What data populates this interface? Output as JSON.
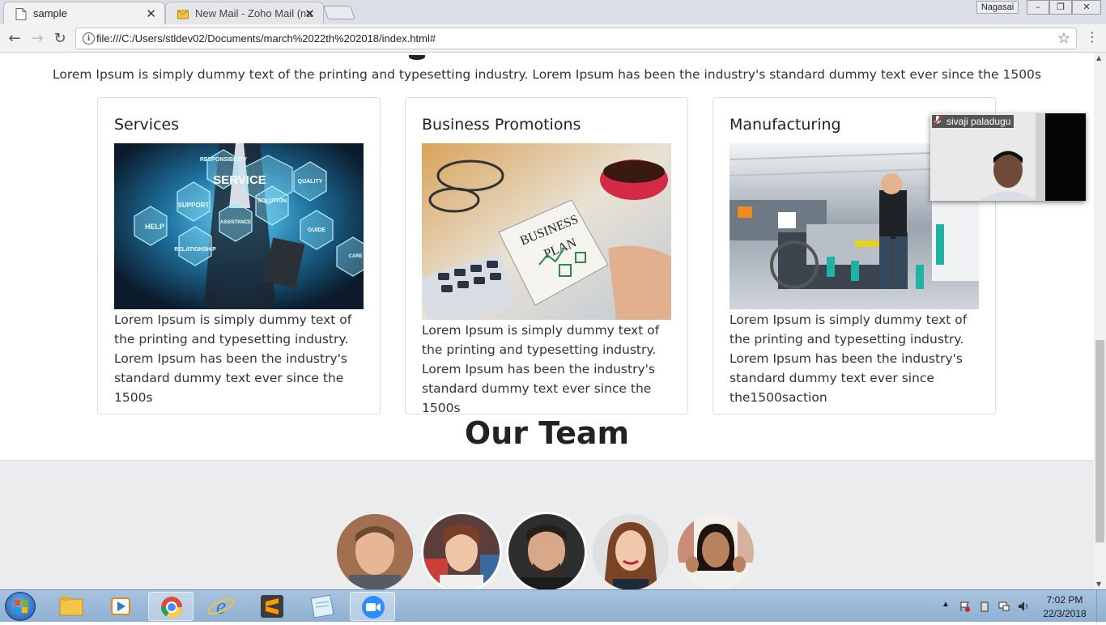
{
  "browser": {
    "tabs": [
      {
        "title": "sample",
        "active": true
      },
      {
        "title": "New Mail - Zoho Mail (na",
        "active": false
      }
    ],
    "user_chip": "Nagasai",
    "url": "file:///C:/Users/stldev02/Documents/march%2022th%202018/index.html#",
    "window_buttons": [
      "–",
      "❐",
      "✕"
    ]
  },
  "page": {
    "intro": "Lorem Ipsum is simply dummy text of the printing and typesetting industry. Lorem Ipsum has been the industry's standard dummy text ever since the 1500s",
    "cards": [
      {
        "title": "Services",
        "text": "Lorem Ipsum is simply dummy text of the printing and typesetting industry. Lorem Ipsum has been the industry's standard dummy text ever since the 1500s",
        "image_labels": [
          "RESPONSIBILITY",
          "SERVICE",
          "QUALITY",
          "SUPPORT",
          "SOLUTION",
          "HELP",
          "ASSISTANCE",
          "GUIDE",
          "RELATIONSHIP",
          "CARE"
        ]
      },
      {
        "title": "Business Promotions",
        "text": "Lorem Ipsum is simply dummy text of the printing and typesetting industry. Lorem Ipsum has been the industry's standard dummy text ever since the 1500s",
        "image_labels": [
          "BUSINESS",
          "PLAN"
        ]
      },
      {
        "title": "Manufacturing",
        "text": "Lorem Ipsum is simply dummy text of the printing and typesetting industry. Lorem Ipsum has been the industry's standard dummy text ever since the1500saction"
      }
    ],
    "team_heading": "Our Team"
  },
  "video_overlay": {
    "name": "sivaji paladugu"
  },
  "taskbar": {
    "time": "7:02 PM",
    "date": "22/3/2018"
  },
  "colors": {
    "taskbar": "#9bb9da",
    "team_band": "#ebecee",
    "card_border": "#dddddd"
  }
}
